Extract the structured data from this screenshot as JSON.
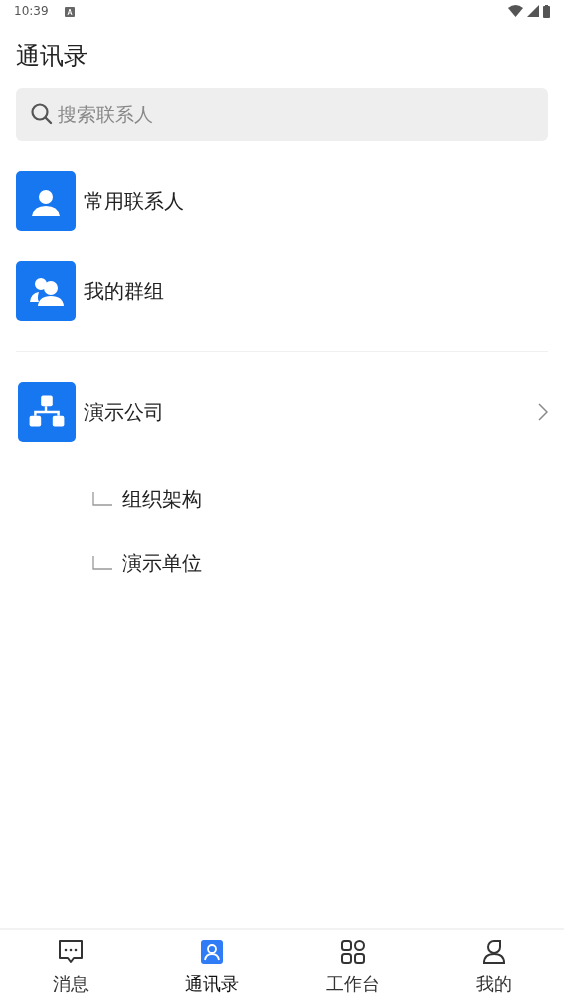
{
  "status_bar": {
    "time": "10:39"
  },
  "title": "通讯录",
  "search": {
    "placeholder": "搜索联系人"
  },
  "shortcuts": [
    {
      "kind": "person",
      "label": "常用联系人"
    },
    {
      "kind": "group",
      "label": "我的群组"
    }
  ],
  "organizations": [
    {
      "label": "演示公司",
      "children": [
        {
          "label": "组织架构"
        },
        {
          "label": "演示单位"
        }
      ]
    }
  ],
  "tabs": [
    {
      "kind": "chat",
      "label": "消息",
      "selected": false
    },
    {
      "kind": "contacts",
      "label": "通讯录",
      "selected": true
    },
    {
      "kind": "apps",
      "label": "工作台",
      "selected": false
    },
    {
      "kind": "me",
      "label": "我的",
      "selected": false
    }
  ]
}
